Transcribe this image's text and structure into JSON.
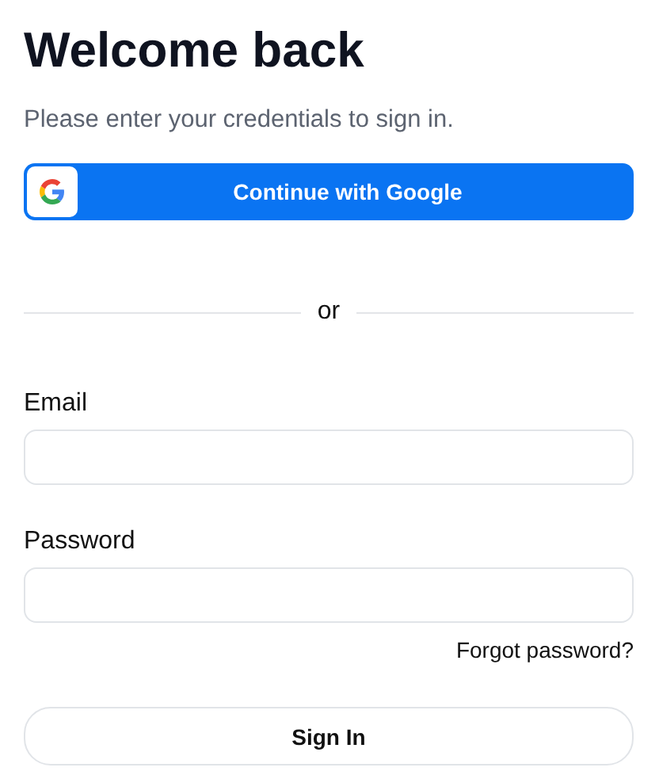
{
  "title": "Welcome back",
  "subtitle": "Please enter your credentials to sign in.",
  "google_button": {
    "label": "Continue with Google"
  },
  "divider": {
    "label": "or"
  },
  "fields": [
    {
      "label": "Email"
    },
    {
      "label": "Password"
    }
  ],
  "forgot_link": "Forgot password?",
  "submit_button": "Sign In"
}
